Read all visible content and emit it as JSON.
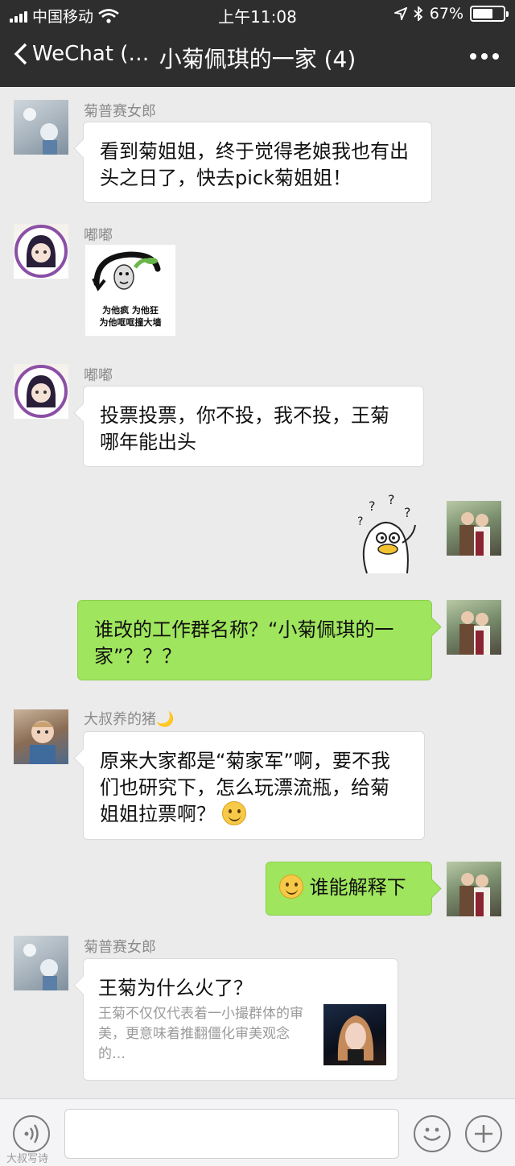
{
  "status_bar": {
    "carrier": "中国移动",
    "time": "上午11:08",
    "battery": "67%",
    "battery_level": 0.67
  },
  "nav": {
    "back_label": "WeChat (…",
    "title": "小菊佩琪的一家 (4)"
  },
  "messages": [
    {
      "sender": "菊普赛女郎",
      "text": "看到菊姐姐，终于觉得老娘我也有出头之日了，快去pick菊姐姐！"
    },
    {
      "sender": "嘟嘟",
      "sticker_caption_1": "为他疯 为他狂",
      "sticker_caption_2": "为他哐哐撞大墙"
    },
    {
      "sender": "嘟嘟",
      "text": "投票投票，你不投，我不投，王菊哪年能出头"
    },
    {
      "text": "谁改的工作群名称？“小菊佩琪的一家”？？？"
    },
    {
      "sender": "大叔养的猪🌙",
      "text": "原来大家都是“菊家军”啊，要不我们也研究下，怎么玩漂流瓶，给菊姐姐拉票啊？"
    },
    {
      "text": "谁能解释下"
    },
    {
      "sender": "菊普赛女郎",
      "link_title": "王菊为什么火了？",
      "link_desc": "王菊不仅仅代表着一小撮群体的审美，更意味着推翻僵化审美观念的…"
    }
  ],
  "watermark": "大叔写诗",
  "colors": {
    "header_bg": "#2e2e2e",
    "chat_bg": "#ebebeb",
    "bubble_right": "#9fe55d",
    "bubble_left": "#ffffff"
  },
  "icons": [
    "back-chevron-icon",
    "more-dots-icon",
    "wifi-icon",
    "location-arrow-icon",
    "bluetooth-icon",
    "battery-icon",
    "voice-icon",
    "emoji-icon",
    "plus-icon"
  ]
}
